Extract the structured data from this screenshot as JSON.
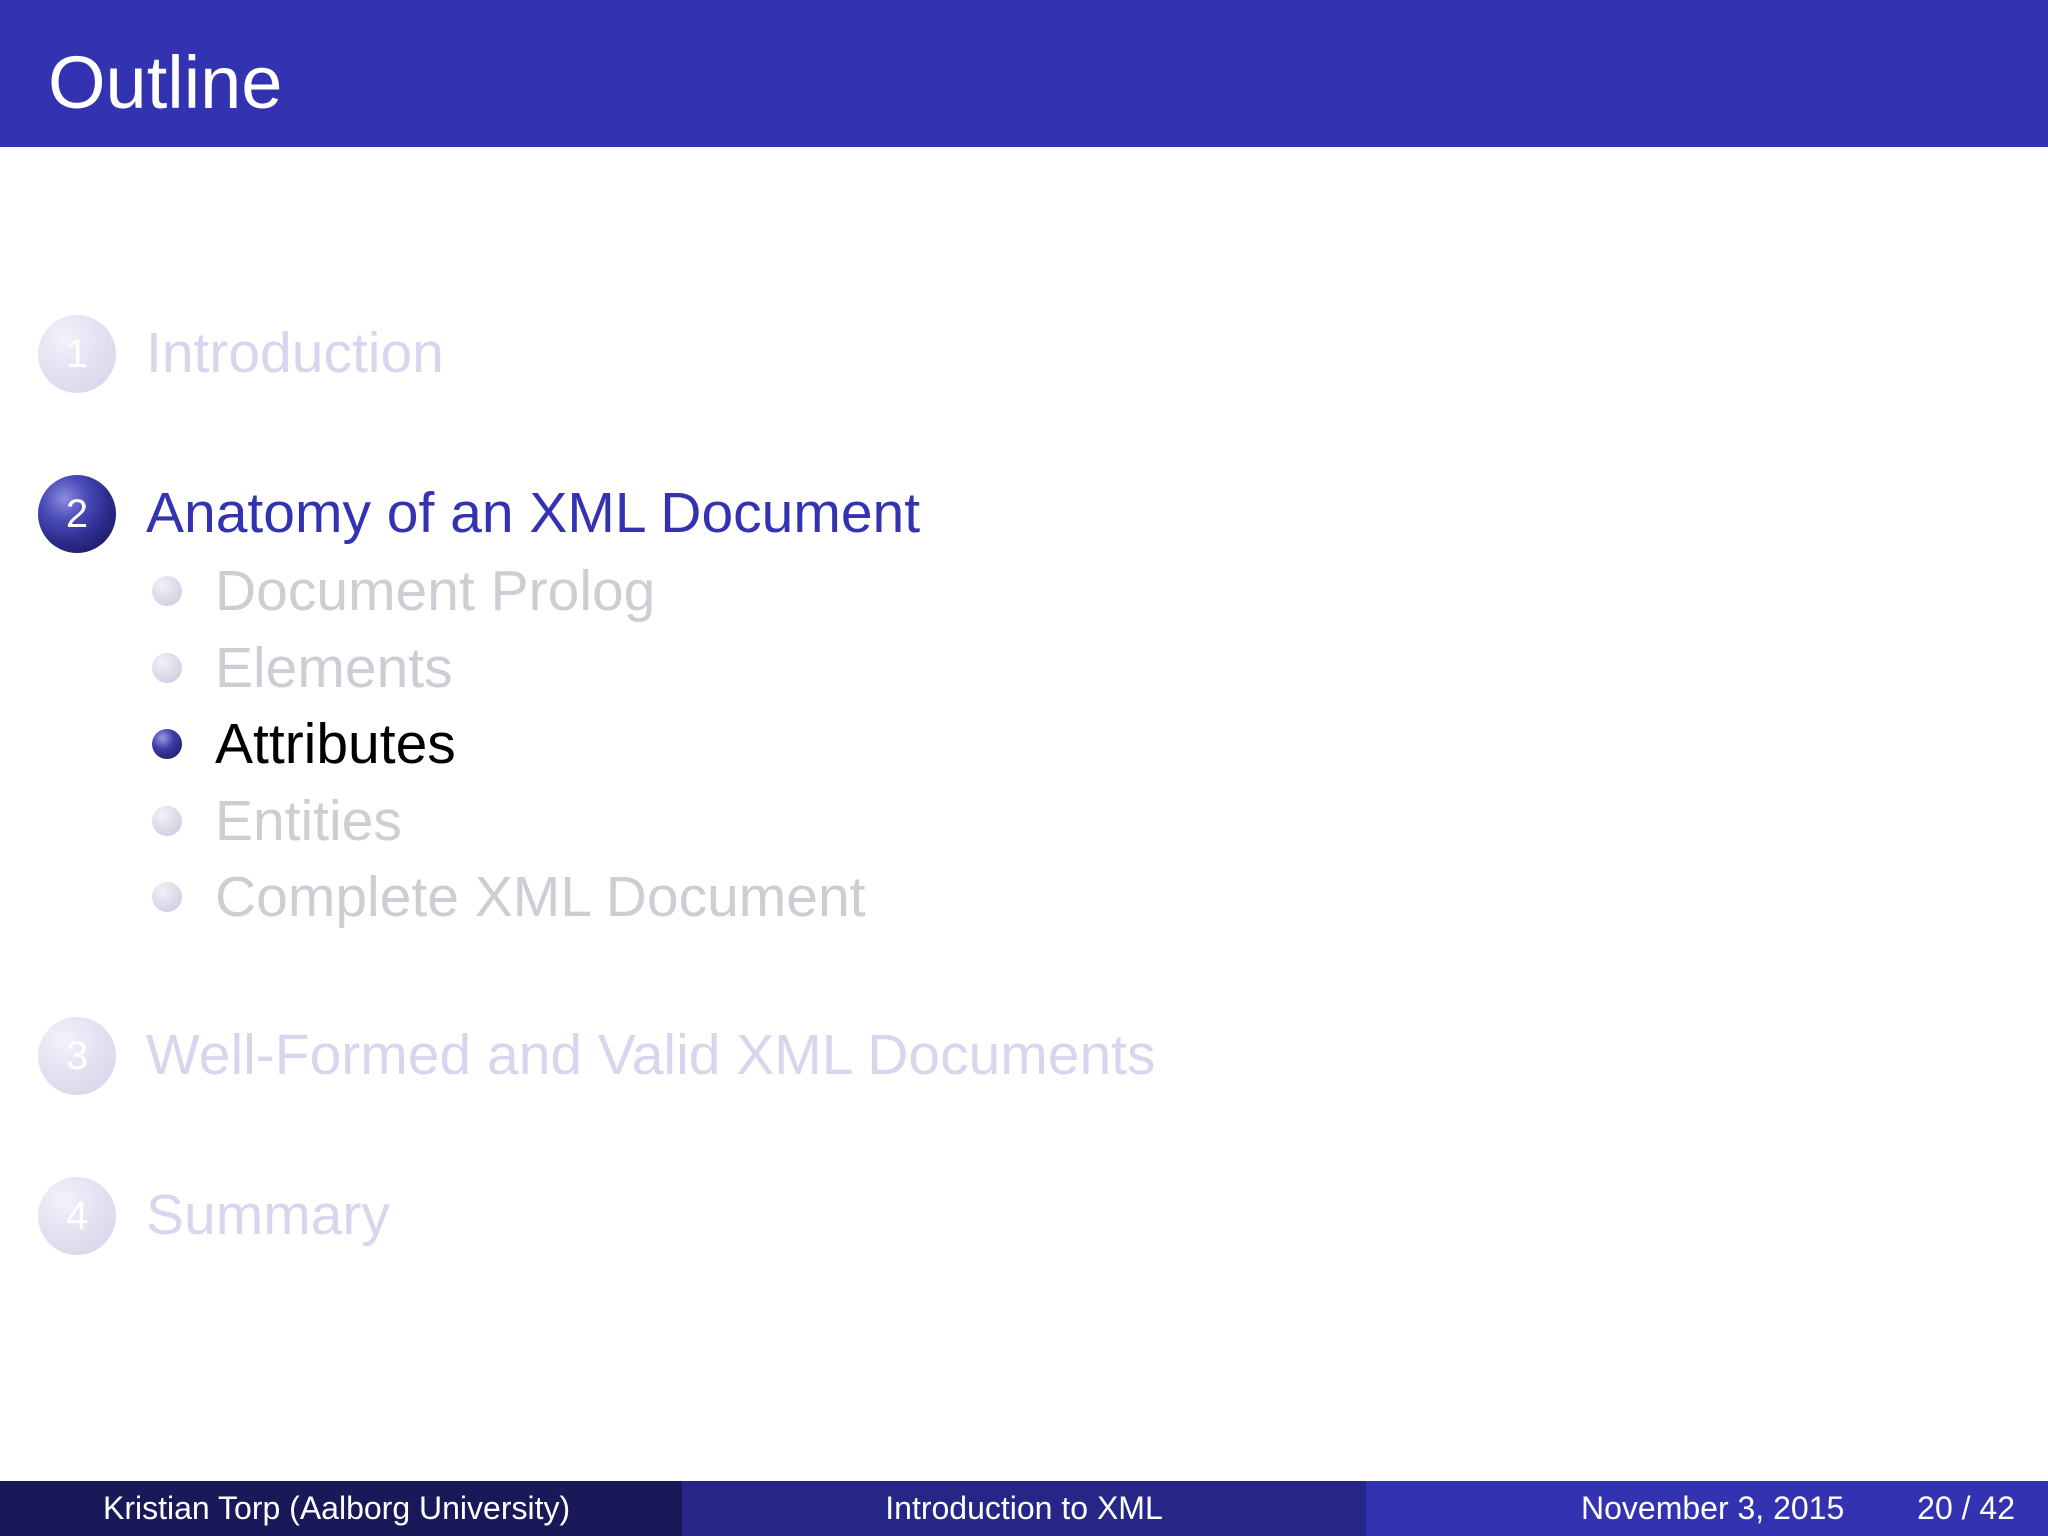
{
  "slide": {
    "title": "Outline"
  },
  "outline": {
    "sections": [
      {
        "number": "1",
        "label": "Introduction",
        "state": "faded"
      },
      {
        "number": "2",
        "label": "Anatomy of an XML Document",
        "state": "active",
        "subsections": [
          {
            "label": "Document Prolog",
            "state": "faded"
          },
          {
            "label": "Elements",
            "state": "faded"
          },
          {
            "label": "Attributes",
            "state": "active"
          },
          {
            "label": "Entities",
            "state": "faded"
          },
          {
            "label": "Complete XML Document",
            "state": "faded"
          }
        ]
      },
      {
        "number": "3",
        "label": "Well-Formed and Valid XML Documents",
        "state": "faded"
      },
      {
        "number": "4",
        "label": "Summary",
        "state": "faded"
      }
    ]
  },
  "footer": {
    "author": "Kristian Torp  (Aalborg University)",
    "presentation_title": "Introduction to XML",
    "date": "November 3, 2015",
    "page": "20 / 42"
  },
  "colors": {
    "header_bg": "#3333b2",
    "footer_left_bg": "#191959",
    "footer_mid_bg": "#262686",
    "footer_right_bg": "#3333b2",
    "active_text": "#3333b2",
    "faded_section_text": "#d6d6ef",
    "faded_subsection_text": "#cdcdd4"
  }
}
